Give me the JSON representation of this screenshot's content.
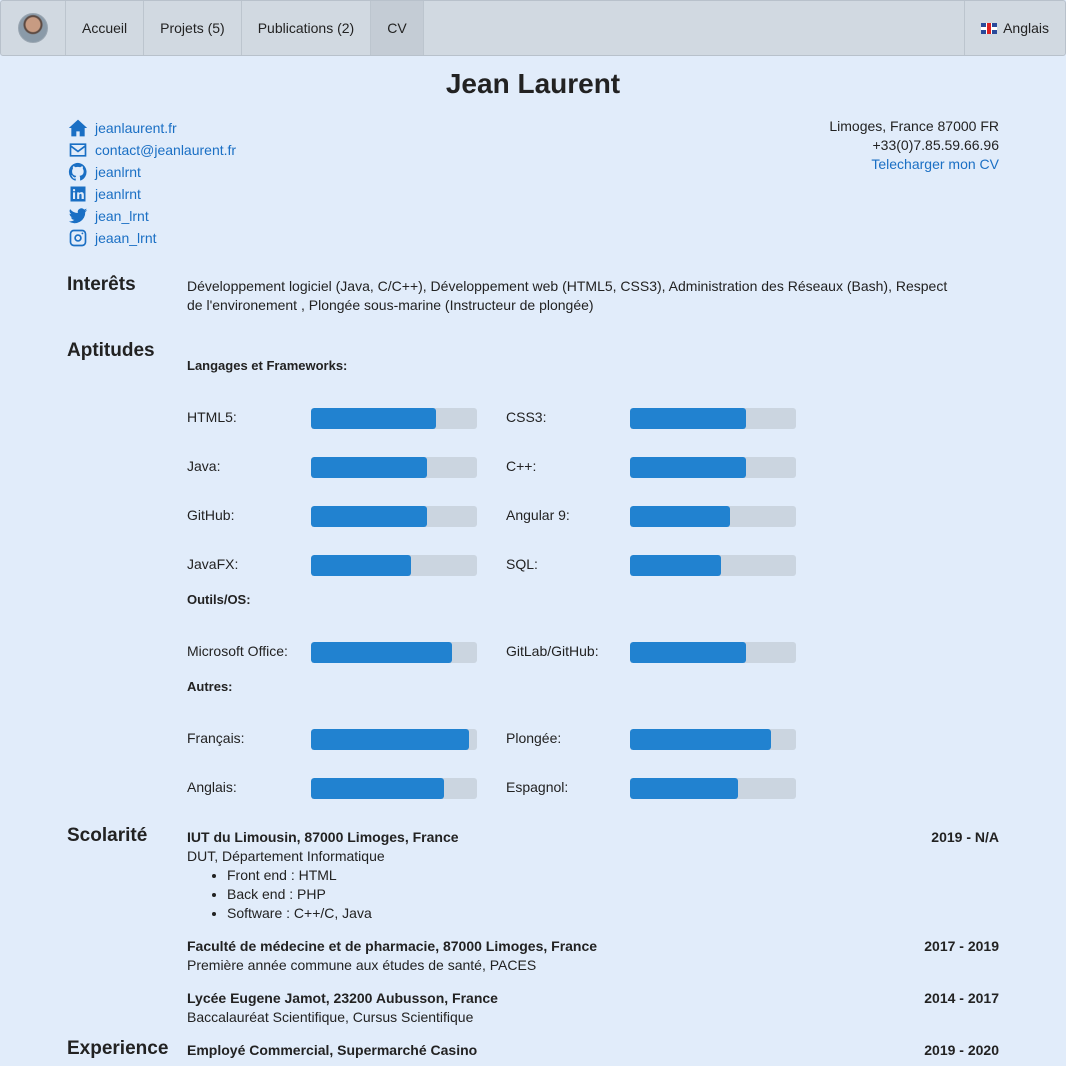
{
  "nav": {
    "items": [
      "Accueil",
      "Projets (5)",
      "Publications (2)",
      "CV"
    ],
    "active": "CV",
    "language": "Anglais"
  },
  "profile": {
    "name": "Jean Laurent",
    "contacts": [
      {
        "icon": "home-icon",
        "text": "jeanlaurent.fr"
      },
      {
        "icon": "mail-icon",
        "text": "contact@jeanlaurent.fr"
      },
      {
        "icon": "github-icon",
        "text": "jeanlrnt"
      },
      {
        "icon": "linkedin-icon",
        "text": "jeanlrnt"
      },
      {
        "icon": "twitter-icon",
        "text": "jean_lrnt"
      },
      {
        "icon": "instagram-icon",
        "text": "jeaan_lrnt"
      }
    ],
    "location": "Limoges, France 87000 FR",
    "phone": "+33(0)7.85.59.66.96",
    "download": "Telecharger mon CV"
  },
  "interests": {
    "title": "Interêts",
    "text": "Développement logiciel (Java, C/C++), Développement web (HTML5, CSS3), Administration des Réseaux (Bash), Respect de l'environement , Plongée sous-marine (Instructeur de plongée)"
  },
  "skills": {
    "title": "Aptitudes",
    "groups": [
      {
        "name": "Langages et Frameworks:",
        "items": [
          {
            "label": "HTML5:",
            "level": 0.75
          },
          {
            "label": "CSS3:",
            "level": 0.7
          },
          {
            "label": "Java:",
            "level": 0.7
          },
          {
            "label": "C++:",
            "level": 0.7
          },
          {
            "label": "GitHub:",
            "level": 0.7
          },
          {
            "label": "Angular 9:",
            "level": 0.6
          },
          {
            "label": "JavaFX:",
            "level": 0.6
          },
          {
            "label": "SQL:",
            "level": 0.55
          }
        ]
      },
      {
        "name": "Outils/OS:",
        "items": [
          {
            "label": "Microsoft Office:",
            "level": 0.85
          },
          {
            "label": "GitLab/GitHub:",
            "level": 0.7
          }
        ]
      },
      {
        "name": "Autres:",
        "items": [
          {
            "label": "Français:",
            "level": 0.95
          },
          {
            "label": "Plongée:",
            "level": 0.85
          },
          {
            "label": "Anglais:",
            "level": 0.8
          },
          {
            "label": "Espagnol:",
            "level": 0.65
          }
        ]
      }
    ]
  },
  "education": {
    "title": "Scolarité",
    "entries": [
      {
        "school": "IUT du Limousin, 87000 Limoges, France",
        "years": "2019 - N/A",
        "degree": "DUT, Département Informatique",
        "bullets": [
          "Front end : HTML",
          "Back end : PHP",
          "Software : C++/C, Java"
        ]
      },
      {
        "school": "Faculté de médecine et de pharmacie, 87000 Limoges, France",
        "years": "2017 - 2019",
        "degree": "Première année commune aux études de santé, PACES",
        "bullets": []
      },
      {
        "school": "Lycée Eugene Jamot, 23200 Aubusson, France",
        "years": "2014 - 2017",
        "degree": "Baccalauréat Scientifique, Cursus Scientifique",
        "bullets": []
      }
    ]
  },
  "experience": {
    "title": "Experience",
    "entries": [
      {
        "role": "Employé Commercial, Supermarché Casino",
        "years": "2019 - 2020"
      }
    ]
  },
  "colors": {
    "background": "#e1ecfa",
    "navbar": "#d1d9e1",
    "accent": "#2182d0",
    "link": "#1a6fc4",
    "bar_track": "#cbd5e0"
  }
}
